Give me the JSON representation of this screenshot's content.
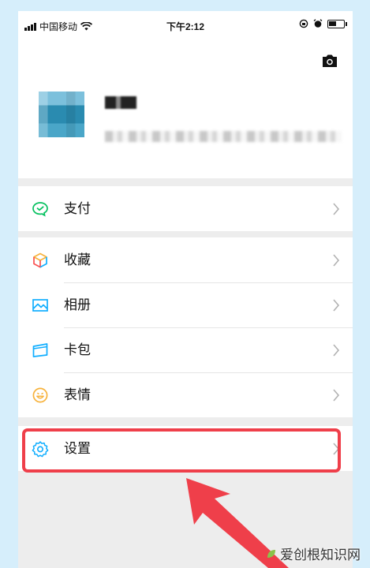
{
  "status_bar": {
    "carrier": "中国移动",
    "time": "下午2:12",
    "battery_level": 0.5
  },
  "menu": {
    "pay": "支付",
    "favorites": "收藏",
    "album": "相册",
    "cards": "卡包",
    "stickers": "表情",
    "settings": "设置"
  },
  "colors": {
    "accent_green": "#07c160",
    "highlight_red": "#ef3f4a",
    "page_bg": "#ededed",
    "frame_bg": "#d6eefb"
  },
  "watermark": {
    "text": "爱创根知识网"
  }
}
